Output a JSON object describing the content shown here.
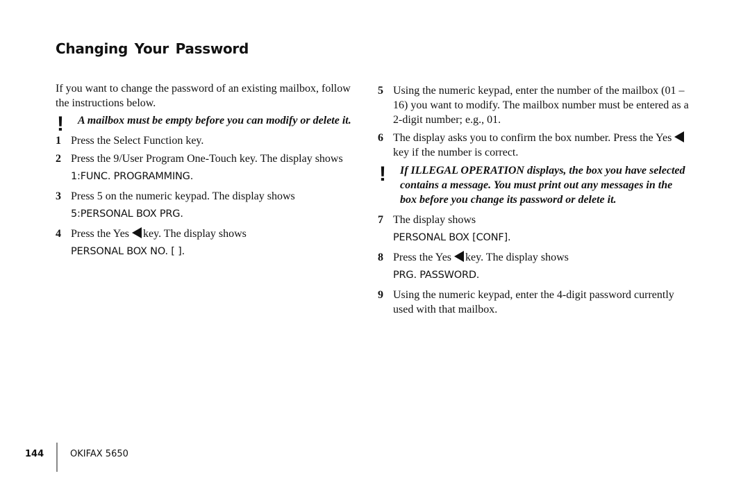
{
  "page": {
    "title": "Changing Your Password",
    "intro": "If you want to change the password of an existing mailbox, follow the instructions below.",
    "warning_1": "A mailbox must be empty before you can modify or delete it.",
    "warning_2": "If ILLEGAL OPERATION displays, the box you have selected contains a message. You must print out any messages in the box before you change its password or delete it.",
    "warning_icon": "exclamation-icon",
    "key_icon": "yes-left-arrow-icon"
  },
  "steps": [
    {
      "num": "1",
      "text": "Press the Select Function key."
    },
    {
      "num": "2",
      "text": "Press the 9/User Program One-Touch key. The display shows",
      "display": "1:FUNC. PROGRAMMING."
    },
    {
      "num": "3",
      "text": "Press 5 on the numeric keypad. The display shows",
      "display": "5:PERSONAL BOX PRG."
    },
    {
      "num": "4",
      "text_before": "Press the Yes",
      "text_after": "key. The display shows",
      "display": "PERSONAL BOX NO. [ ]."
    },
    {
      "num": "5",
      "text": "Using the numeric keypad, enter the number of the mailbox (01 – 16) you want to modify. The mailbox number must be entered as a 2-digit number; e.g., 01."
    },
    {
      "num": "6",
      "text_before": "The display asks you to confirm the box number. Press the Yes",
      "text_after": "key if the number is correct."
    },
    {
      "num": "7",
      "text": "The display shows",
      "display": "PERSONAL BOX [CONF]."
    },
    {
      "num": "8",
      "text_before": "Press the Yes",
      "text_after": "key. The display shows",
      "display": "PRG. PASSWORD."
    },
    {
      "num": "9",
      "text": "Using the numeric keypad, enter the 4-digit password currently used with that mailbox."
    }
  ],
  "footer": {
    "page_number": "144",
    "product": "OKIFAX 5650"
  }
}
